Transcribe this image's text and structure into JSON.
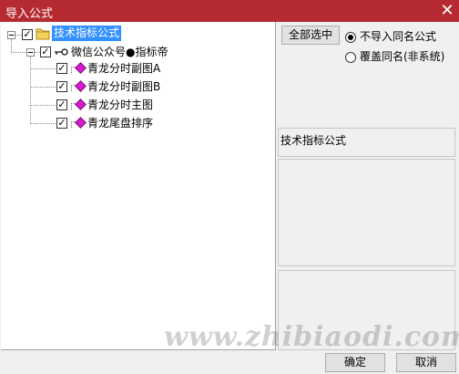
{
  "window": {
    "title": "导入公式",
    "close_glyph": "✕"
  },
  "tree": {
    "root": {
      "label": "技术指标公式",
      "checked": true
    },
    "group": {
      "label": "微信公众号●指标帝",
      "checked": true
    },
    "items": [
      {
        "label": "青龙分时副图A",
        "checked": true
      },
      {
        "label": "青龙分时副图B",
        "checked": true
      },
      {
        "label": "青龙分时主图",
        "checked": true
      },
      {
        "label": "青龙尾盘排序",
        "checked": true
      }
    ],
    "check_glyph": "✓"
  },
  "options": {
    "select_all_label": "全部选中",
    "radios": [
      {
        "label": "不导入同名公式",
        "selected": true
      },
      {
        "label": "覆盖同名(非系统)",
        "selected": false
      }
    ]
  },
  "info": {
    "title": "技术指标公式"
  },
  "footer": {
    "ok_label": "确定",
    "cancel_label": "取消"
  },
  "watermark": "www.zhibiaodi.com",
  "colors": {
    "titlebar": "#b52b31",
    "selection": "#3390ff",
    "item_icon": "#d81bd0"
  }
}
